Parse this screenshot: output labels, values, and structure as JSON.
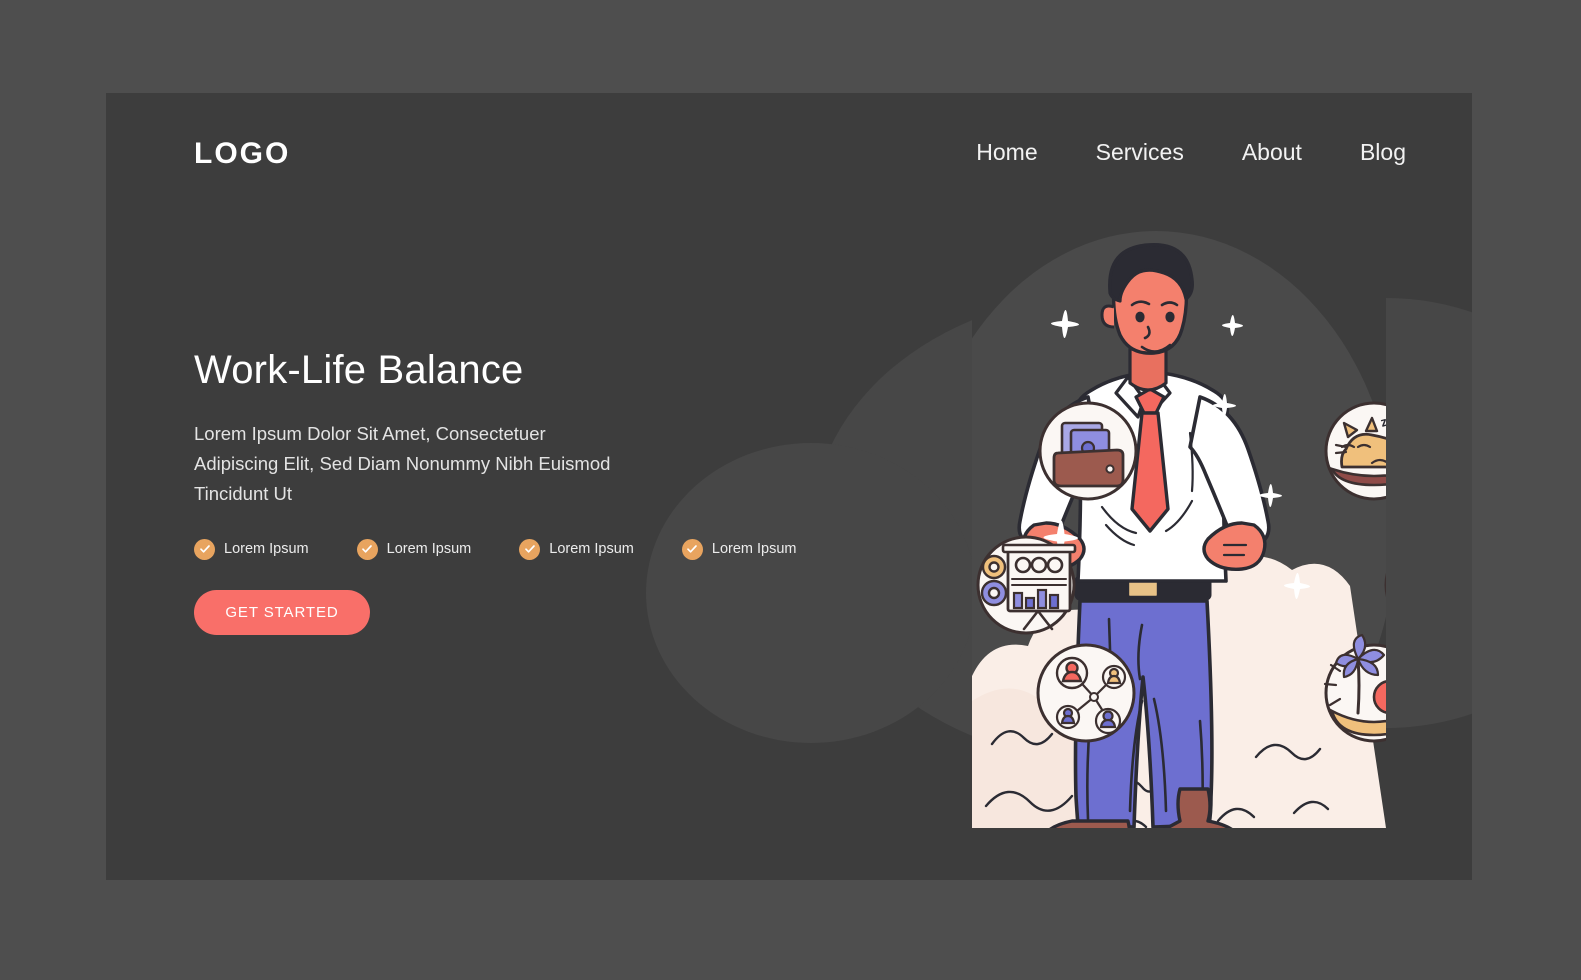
{
  "page": {
    "background_color": "#4e4e4e",
    "card_color": "#3d3d3d",
    "accent_color": "#f96f69",
    "check_color": "#e8a45f"
  },
  "header": {
    "logo": "LOGO",
    "nav": [
      {
        "label": "Home"
      },
      {
        "label": "Services"
      },
      {
        "label": "About"
      },
      {
        "label": "Blog"
      }
    ]
  },
  "hero": {
    "title": "Work-Life Balance",
    "body": "Lorem Ipsum Dolor Sit Amet, Consectetuer Adipiscing Elit, Sed Diam Nonummy Nibh Euismod Tincidunt Ut",
    "features": [
      {
        "label": "Lorem Ipsum",
        "icon": "check-icon"
      },
      {
        "label": "Lorem Ipsum",
        "icon": "check-icon"
      },
      {
        "label": "Lorem Ipsum",
        "icon": "check-icon"
      },
      {
        "label": "Lorem Ipsum",
        "icon": "check-icon"
      }
    ],
    "cta_label": "GET STARTED"
  },
  "illustration": {
    "subject": "businessman-hands-on-hips",
    "bubbles": [
      {
        "icon": "wallet-money-icon",
        "position": "top-left"
      },
      {
        "icon": "sleeping-cat-icon",
        "position": "top-right"
      },
      {
        "icon": "presentation-chart-icon",
        "position": "middle-left"
      },
      {
        "icon": "bottles-cheers-icon",
        "position": "middle-right"
      },
      {
        "icon": "social-network-icon",
        "position": "bottom-left"
      },
      {
        "icon": "beach-palm-icon",
        "position": "bottom-right"
      }
    ],
    "sparkles": 7,
    "colors": {
      "skin": "#f4806d",
      "shirt": "#ffffff",
      "tie": "#f4685f",
      "trousers": "#6d6fd0",
      "shoes": "#9c5a4e",
      "ground": "#faeee7",
      "hair": "#2b2b33"
    }
  }
}
